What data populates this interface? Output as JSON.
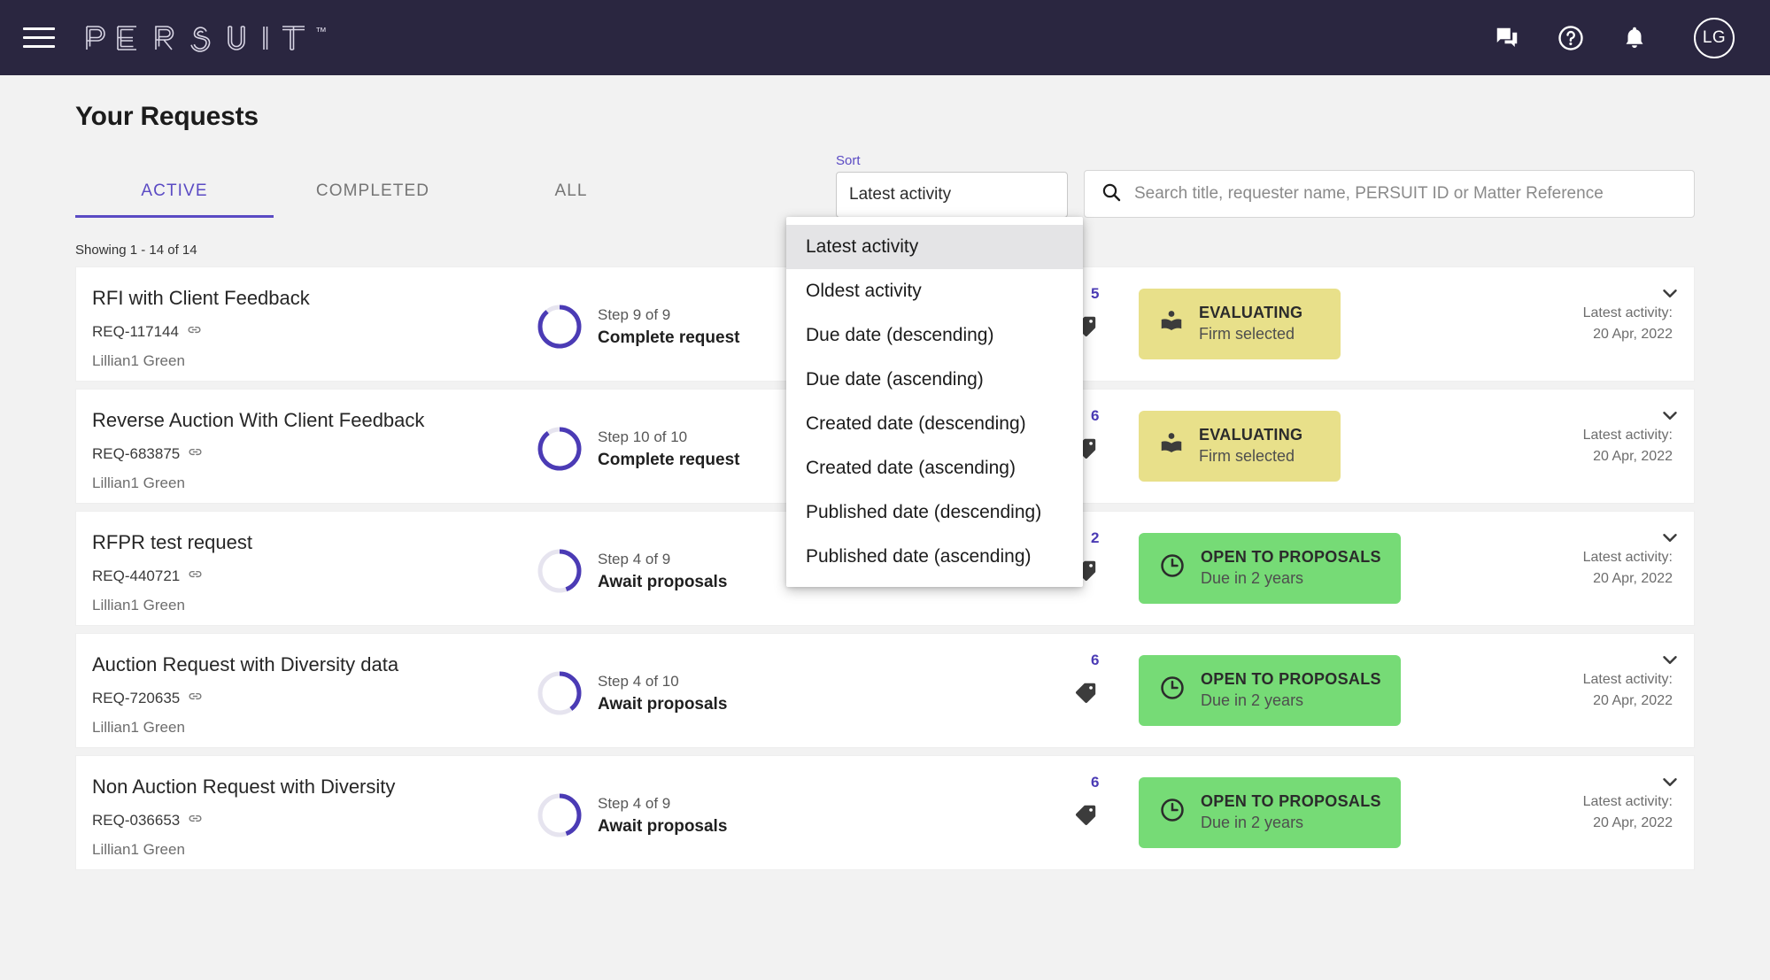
{
  "topbar": {
    "menu_icon": "hamburger-menu-icon",
    "logo_text": "PERSUIT",
    "logo_tm": "™",
    "icons": [
      {
        "name": "chat-icon",
        "label": "Messages"
      },
      {
        "name": "help-icon",
        "label": "Help"
      },
      {
        "name": "notifications-icon",
        "label": "Notifications"
      }
    ],
    "avatar_initials": "LG",
    "background_color": "#2a2640"
  },
  "page": {
    "title": "Your Requests",
    "showing": "Showing 1 - 14 of 14"
  },
  "tabs": [
    {
      "label": "ACTIVE",
      "active": true
    },
    {
      "label": "COMPLETED",
      "active": false
    },
    {
      "label": "ALL",
      "active": false
    }
  ],
  "sort": {
    "label": "Sort",
    "selected": "Latest activity",
    "options": [
      "Latest activity",
      "Oldest activity",
      "Due date (descending)",
      "Due date (ascending)",
      "Created date (descending)",
      "Created date (ascending)",
      "Published date (descending)",
      "Published date (ascending)"
    ]
  },
  "search": {
    "value": "",
    "placeholder": "Search title, requester name, PERSUIT ID or Matter Reference",
    "icon": "search-icon"
  },
  "colors": {
    "accent_purple": "#5b4bc4",
    "badge_yellow": "#e8e08a",
    "badge_green": "#76db76",
    "header_dark": "#2a2640"
  },
  "requests": [
    {
      "title": "RFI with Client Feedback",
      "req_id": "REQ-117144",
      "owner": "Lillian1 Green",
      "step_label": "Step 9 of 9",
      "step_name": "Complete request",
      "step_current": 9,
      "step_total": 9,
      "tag_count": "5",
      "status_title": "EVALUATING",
      "status_sub": "Firm selected",
      "status_color": "#e8e08a",
      "status_icon": "evaluating-icon",
      "activity_label": "Latest activity:",
      "activity_date": "20 Apr, 2022"
    },
    {
      "title": "Reverse Auction With Client Feedback",
      "req_id": "REQ-683875",
      "owner": "Lillian1 Green",
      "step_label": "Step 10 of 10",
      "step_name": "Complete request",
      "step_current": 10,
      "step_total": 10,
      "tag_count": "6",
      "status_title": "EVALUATING",
      "status_sub": "Firm selected",
      "status_color": "#e8e08a",
      "status_icon": "evaluating-icon",
      "activity_label": "Latest activity:",
      "activity_date": "20 Apr, 2022"
    },
    {
      "title": "RFPR test request",
      "req_id": "REQ-440721",
      "owner": "Lillian1 Green",
      "step_label": "Step 4 of 9",
      "step_name": "Await proposals",
      "step_current": 4,
      "step_total": 9,
      "tag_count": "2",
      "status_title": "OPEN TO PROPOSALS",
      "status_sub": "Due in 2 years",
      "status_color": "#76db76",
      "status_icon": "clock-icon",
      "activity_label": "Latest activity:",
      "activity_date": "20 Apr, 2022"
    },
    {
      "title": "Auction Request with Diversity data",
      "req_id": "REQ-720635",
      "owner": "Lillian1 Green",
      "step_label": "Step 4 of 10",
      "step_name": "Await proposals",
      "step_current": 4,
      "step_total": 10,
      "tag_count": "6",
      "status_title": "OPEN TO PROPOSALS",
      "status_sub": "Due in 2 years",
      "status_color": "#76db76",
      "status_icon": "clock-icon",
      "activity_label": "Latest activity:",
      "activity_date": "20 Apr, 2022"
    },
    {
      "title": "Non Auction Request with Diversity",
      "req_id": "REQ-036653",
      "owner": "Lillian1 Green",
      "step_label": "Step 4 of 9",
      "step_name": "Await proposals",
      "step_current": 4,
      "step_total": 9,
      "tag_count": "6",
      "status_title": "OPEN TO PROPOSALS",
      "status_sub": "Due in 2 years",
      "status_color": "#76db76",
      "status_icon": "clock-icon",
      "activity_label": "Latest activity:",
      "activity_date": "20 Apr, 2022"
    }
  ]
}
